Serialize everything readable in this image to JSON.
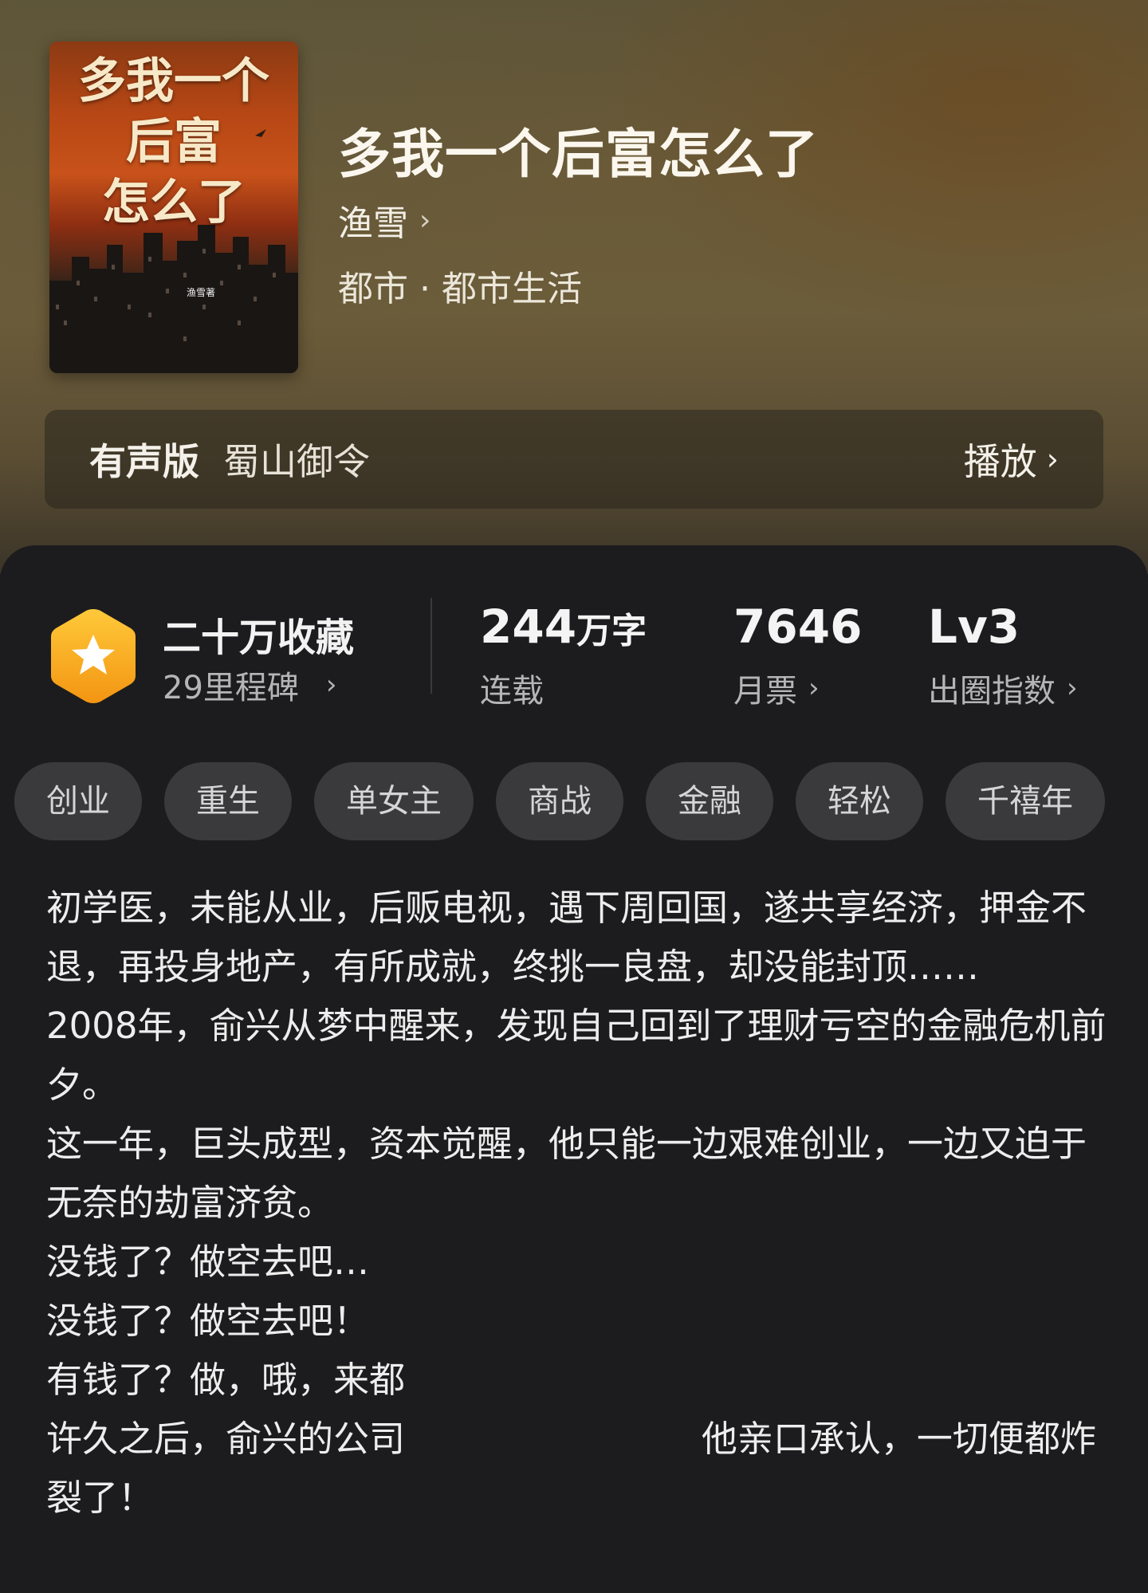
{
  "book": {
    "title": "多我一个后富怎么了",
    "author": "渔雪",
    "genre": "都市 · 都市生活",
    "cover": {
      "title_lines": [
        "多我一个",
        "后富",
        "怎么了"
      ],
      "author_mark": "渔雪著"
    }
  },
  "audio": {
    "label": "有声版",
    "narrator": "蜀山御令",
    "play_label": "播放"
  },
  "stats": {
    "collection": {
      "title": "二十万收藏",
      "milestone": "29里程碑"
    },
    "words": {
      "value": "244",
      "unit": "万字",
      "status": "连载"
    },
    "monthly_tickets": {
      "value": "7646",
      "label": "月票"
    },
    "breakout": {
      "value": "Lv3",
      "label": "出圈指数"
    }
  },
  "tags": [
    "创业",
    "重生",
    "单女主",
    "商战",
    "金融",
    "轻松",
    "千禧年"
  ],
  "synopsis": [
    "初学医，未能从业，后贩电视，遇下周回国，遂共享经济，押金不退，再投身地产，有所成就，终挑一良盘，却没能封顶……",
    "2008年，俞兴从梦中醒来，发现自己回到了理财亏空的金融危机前夕。",
    "这一年，巨头成型，资本觉醒，他只能一边艰难创业，一边又迫于无奈的劫富济贫。",
    "没钱了？做空去吧…",
    "没钱了？做空去吧！",
    "有钱了？做，哦，来都",
    "许久之后，俞兴的公司                          他亲口承认，一切便都炸裂了！"
  ],
  "colors": {
    "panel_bg": "#1c1c1e",
    "tag_bg": "#3a3a3c",
    "badge_orange": "#f7a21b"
  },
  "icons": {
    "badge": "star-hexagon-icon",
    "chevron": "chevron-right-icon"
  }
}
